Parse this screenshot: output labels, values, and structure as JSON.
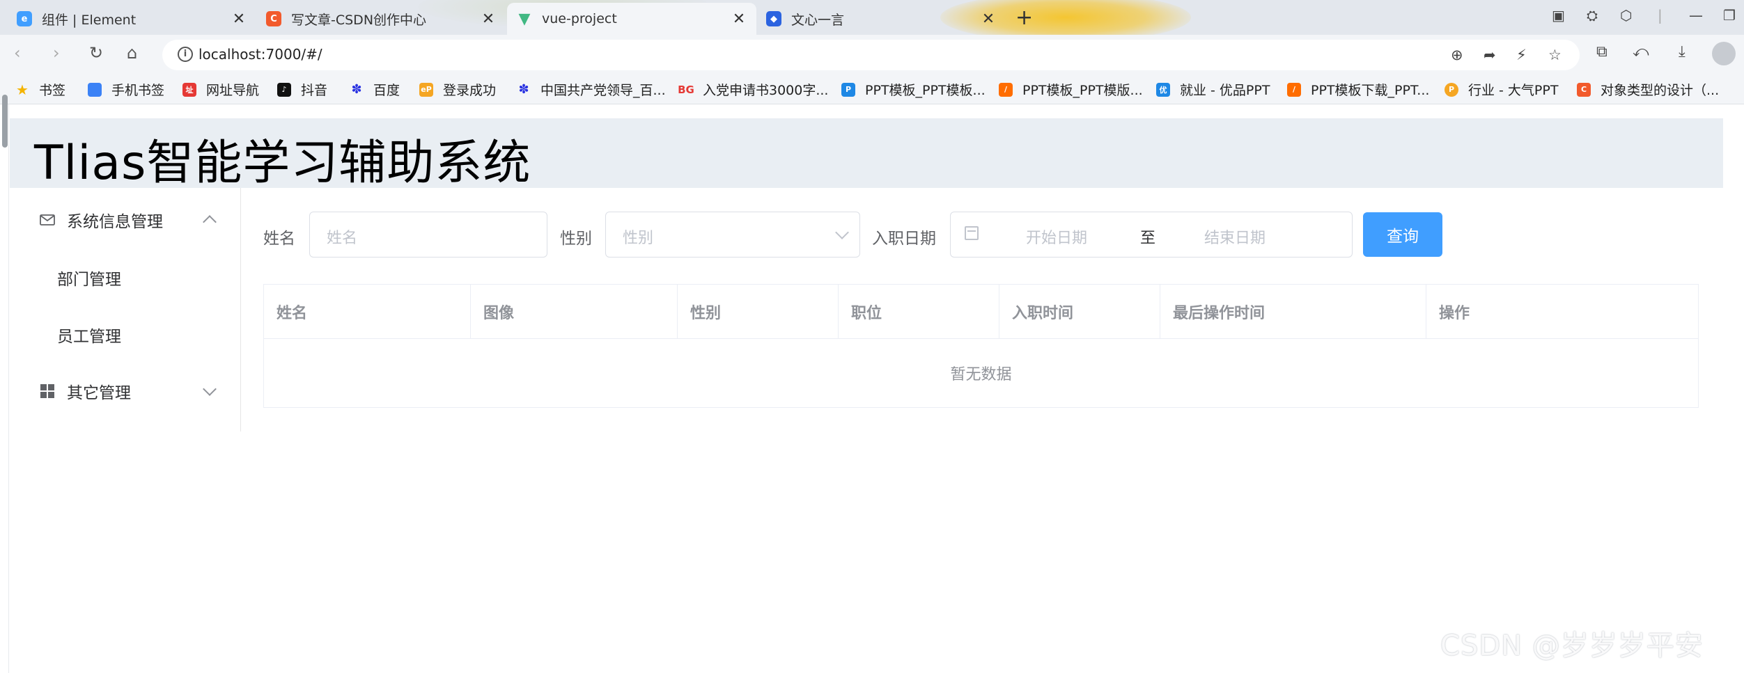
{
  "browser": {
    "tabs": [
      {
        "title": "组件 | Element",
        "favicon": "element-icon",
        "color": "#409eff"
      },
      {
        "title": "写文章-CSDN创作中心",
        "favicon": "csdn-icon",
        "color": "#f25a2c"
      },
      {
        "title": "vue-project",
        "favicon": "vue-icon",
        "color": "#41b883"
      },
      {
        "title": "文心一言",
        "favicon": "ernie-icon",
        "color": "#2b63e0"
      }
    ],
    "url": "localhost:7000/#/",
    "bookmarks": [
      {
        "label": "书签",
        "icon": "star-icon",
        "color": "#f4b400"
      },
      {
        "label": "手机书签",
        "icon": "phone-icon",
        "color": "#3b82f6"
      },
      {
        "label": "网址导航",
        "icon": "nav-icon",
        "color": "#e53935"
      },
      {
        "label": "抖音",
        "icon": "douyin-icon",
        "color": "#111111"
      },
      {
        "label": "百度",
        "icon": "baidu-icon",
        "color": "#2932e1"
      },
      {
        "label": "登录成功",
        "icon": "ep-icon",
        "color": "#f5a623"
      },
      {
        "label": "中国共产党领导_百...",
        "icon": "baidu-icon",
        "color": "#2932e1"
      },
      {
        "label": "入党申请书3000字...",
        "icon": "bg-icon",
        "color": "#e53935"
      },
      {
        "label": "PPT模板_PPT模板...",
        "icon": "ppt-icon",
        "color": "#1e88e5"
      },
      {
        "label": "PPT模板_PPT模版...",
        "icon": "ppt-orange-icon",
        "color": "#ff6d00"
      },
      {
        "label": "就业 - 优品PPT",
        "icon": "youpin-icon",
        "color": "#1e88e5"
      },
      {
        "label": "PPT模板下载_PPT...",
        "icon": "ppt-orange-icon",
        "color": "#ff6d00"
      },
      {
        "label": "行业 - 大气PPT",
        "icon": "p-icon",
        "color": "#f5a623"
      },
      {
        "label": "对象类型的设计（...",
        "icon": "csdn-icon",
        "color": "#f25a2c"
      }
    ]
  },
  "app": {
    "title": "Tlias智能学习辅助系统"
  },
  "sidebar": {
    "groups": [
      {
        "label": "系统信息管理",
        "icon": "envelope-icon",
        "expanded": true,
        "items": [
          {
            "label": "部门管理"
          },
          {
            "label": "员工管理"
          }
        ]
      },
      {
        "label": "其它管理",
        "icon": "grid-icon",
        "expanded": false,
        "items": []
      }
    ]
  },
  "search": {
    "name_label": "姓名",
    "name_placeholder": "姓名",
    "gender_label": "性别",
    "gender_placeholder": "性别",
    "date_label": "入职日期",
    "start_placeholder": "开始日期",
    "range_separator": "至",
    "end_placeholder": "结束日期",
    "query_button": "查询"
  },
  "table": {
    "columns": [
      "姓名",
      "图像",
      "性别",
      "职位",
      "入职时间",
      "最后操作时间",
      "操作"
    ],
    "empty_text": "暂无数据"
  },
  "watermark": "CSDN @岁岁岁平安",
  "colors": {
    "primary": "#409eff",
    "header_bg": "#e9eef3",
    "border": "#dcdfe6",
    "placeholder": "#c0c4cc"
  }
}
